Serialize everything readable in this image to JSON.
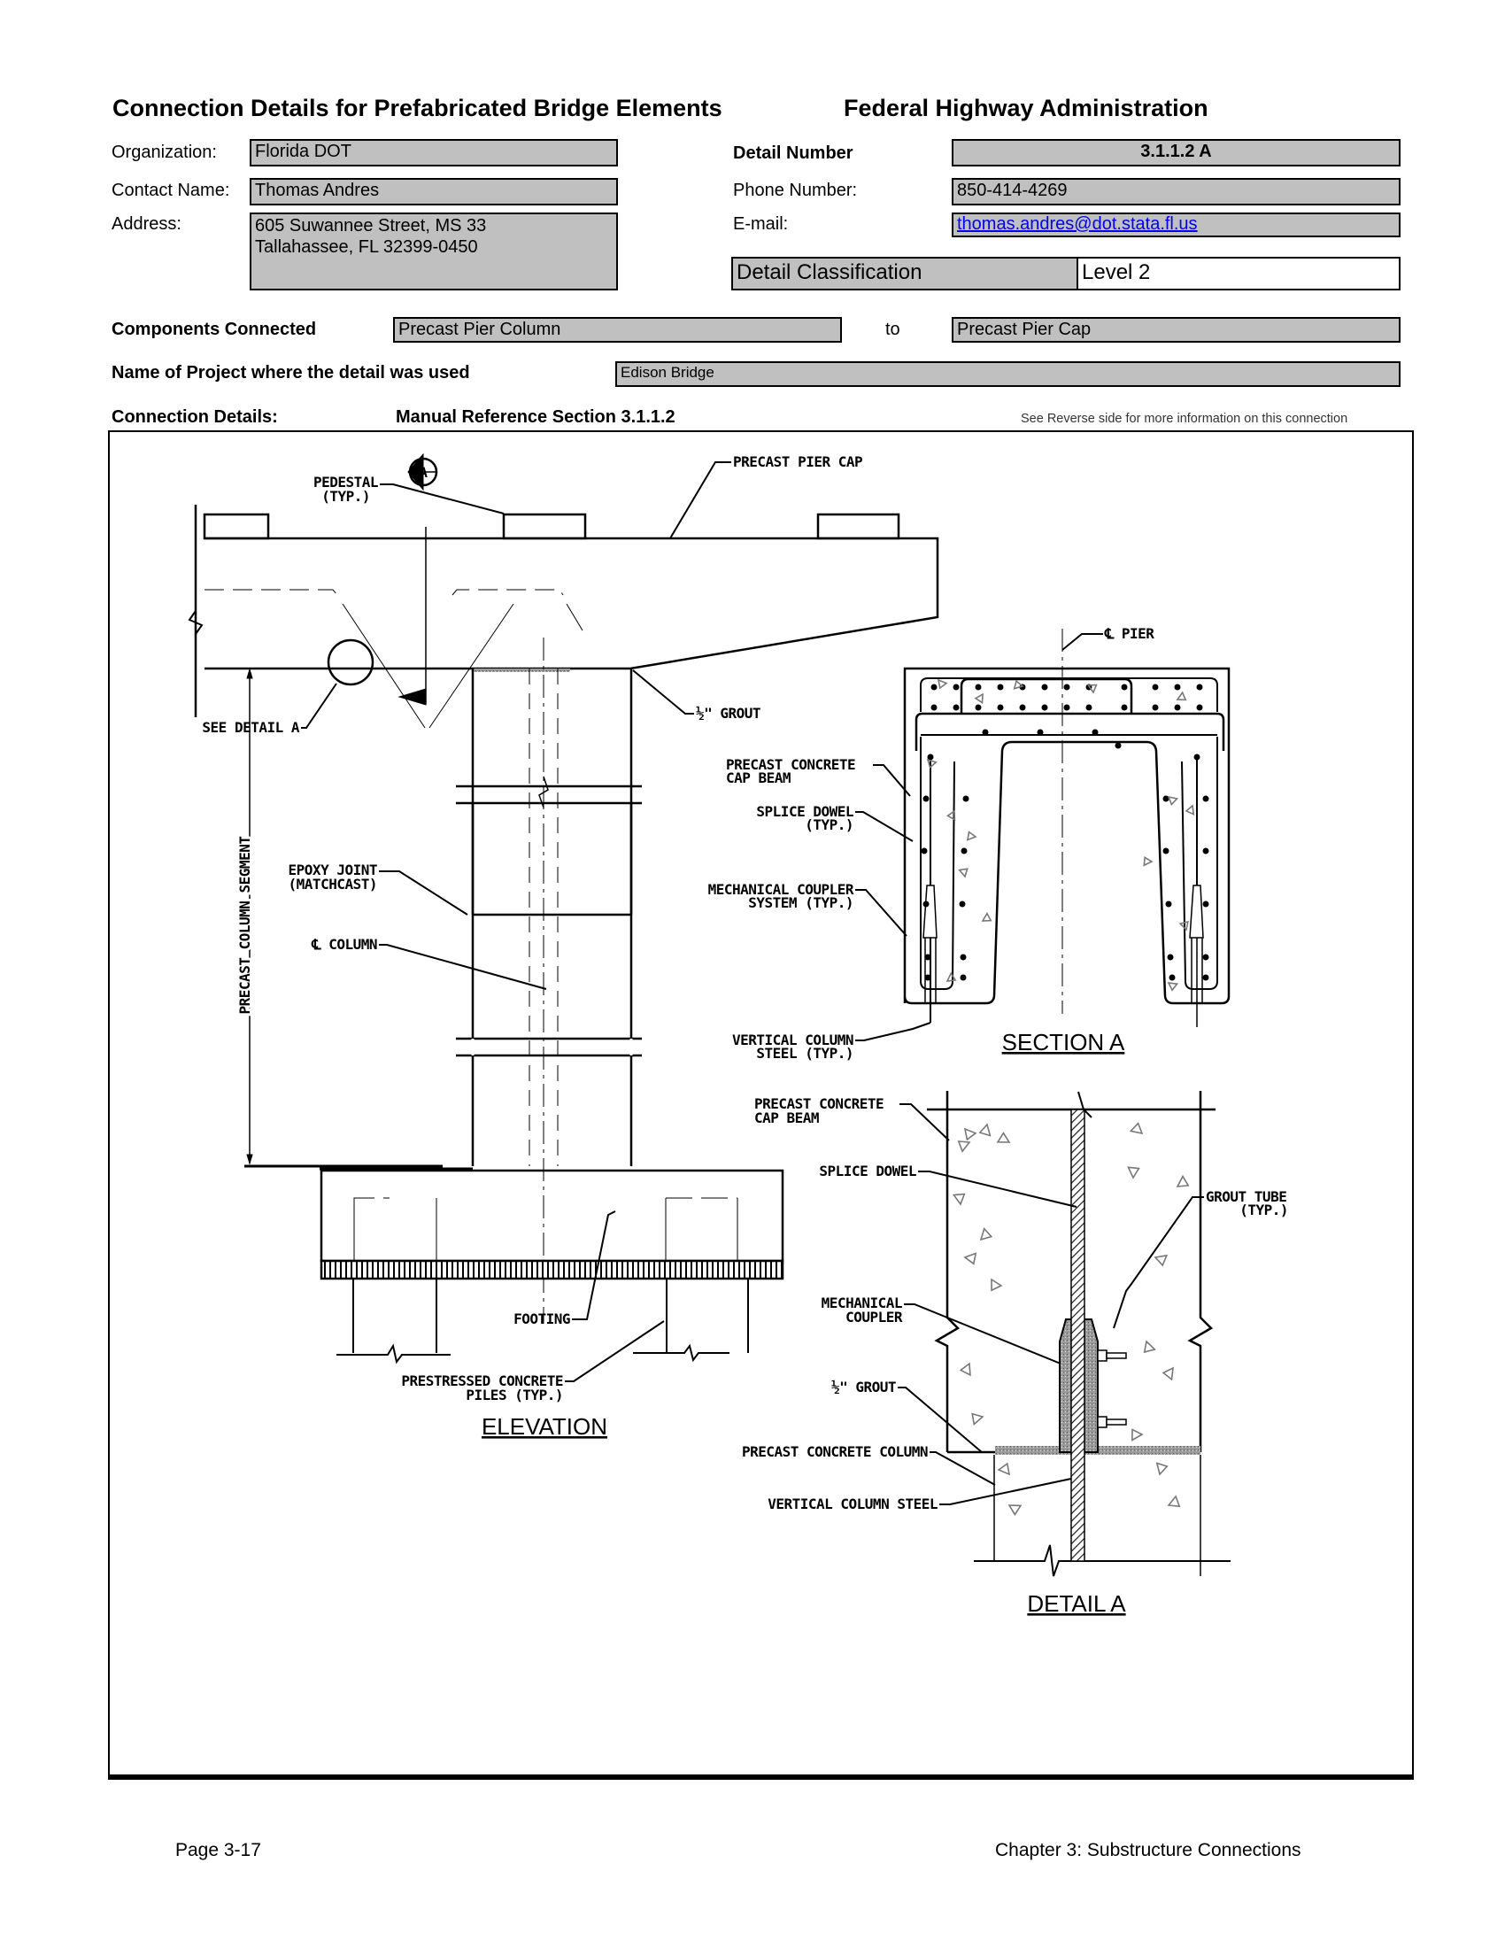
{
  "header": {
    "left_title": "Connection Details for Prefabricated Bridge Elements",
    "right_title": "Federal Highway Administration"
  },
  "contact": {
    "organization_label": "Organization:",
    "organization": "Florida DOT",
    "contact_name_label": "Contact Name:",
    "contact_name": "Thomas Andres",
    "address_label": "Address:",
    "address": "605 Suwannee Street, MS 33\nTallahassee, FL 32399-0450",
    "detail_number_label": "Detail Number",
    "detail_number": "3.1.1.2 A",
    "phone_label": "Phone Number:",
    "phone": "850-414-4269",
    "email_label": "E-mail:",
    "email": "thomas.andres@dot.stata.fl.us"
  },
  "classification": {
    "label": "Detail Classification",
    "value": "Level 2"
  },
  "components": {
    "label": "Components Connected",
    "from": "Precast Pier Column",
    "connector": "to",
    "to": "Precast Pier Cap"
  },
  "project": {
    "label": "Name of Project where the detail was used",
    "value": "Edison Bridge"
  },
  "connection": {
    "label": "Connection Details:",
    "manual_ref": "Manual Reference Section 3.1.1.2",
    "reverse_note": "See Reverse side for more information on this connection"
  },
  "drawing": {
    "elevation": {
      "title": "ELEVATION",
      "section_marker_top": "A",
      "section_marker_bottom": "–",
      "labels": {
        "pedestal_1": "PEDESTAL",
        "pedestal_2": "(TYP.)",
        "precast_pier_cap": "PRECAST PIER CAP",
        "see_detail_a": "SEE DETAIL A",
        "grout": "½\" GROUT",
        "precast_column_segment": "PRECAST COLUMN SEGMENT",
        "epoxy_joint_1": "EPOXY JOINT",
        "epoxy_joint_2": "(MATCHCAST)",
        "cl_column": "℄ COLUMN",
        "footing": "FOOTING",
        "piles_1": "PRESTRESSED CONCRETE",
        "piles_2": "PILES (TYP.)"
      }
    },
    "section_a": {
      "title": "SECTION A",
      "labels": {
        "cl_pier": "℄ PIER",
        "cap_beam_1": "PRECAST CONCRETE",
        "cap_beam_2": "CAP BEAM",
        "splice_dowel_1": "SPLICE DOWEL",
        "splice_dowel_2": "(TYP.)",
        "coupler_1": "MECHANICAL COUPLER",
        "coupler_2": "SYSTEM (TYP.)",
        "col_steel_1": "VERTICAL COLUMN",
        "col_steel_2": "STEEL (TYP.)"
      }
    },
    "detail_a": {
      "title": "DETAIL A",
      "labels": {
        "cap_beam_1": "PRECAST CONCRETE",
        "cap_beam_2": "CAP BEAM",
        "splice_dowel": "SPLICE DOWEL",
        "grout_tube_1": "GROUT TUBE",
        "grout_tube_2": "(TYP.)",
        "coupler_1": "MECHANICAL",
        "coupler_2": "COUPLER",
        "grout": "½\" GROUT",
        "precast_column": "PRECAST CONCRETE COLUMN",
        "col_steel": "VERTICAL COLUMN STEEL"
      }
    }
  },
  "footer": {
    "page": "Page 3-17",
    "chapter": "Chapter 3: Substructure Connections"
  }
}
